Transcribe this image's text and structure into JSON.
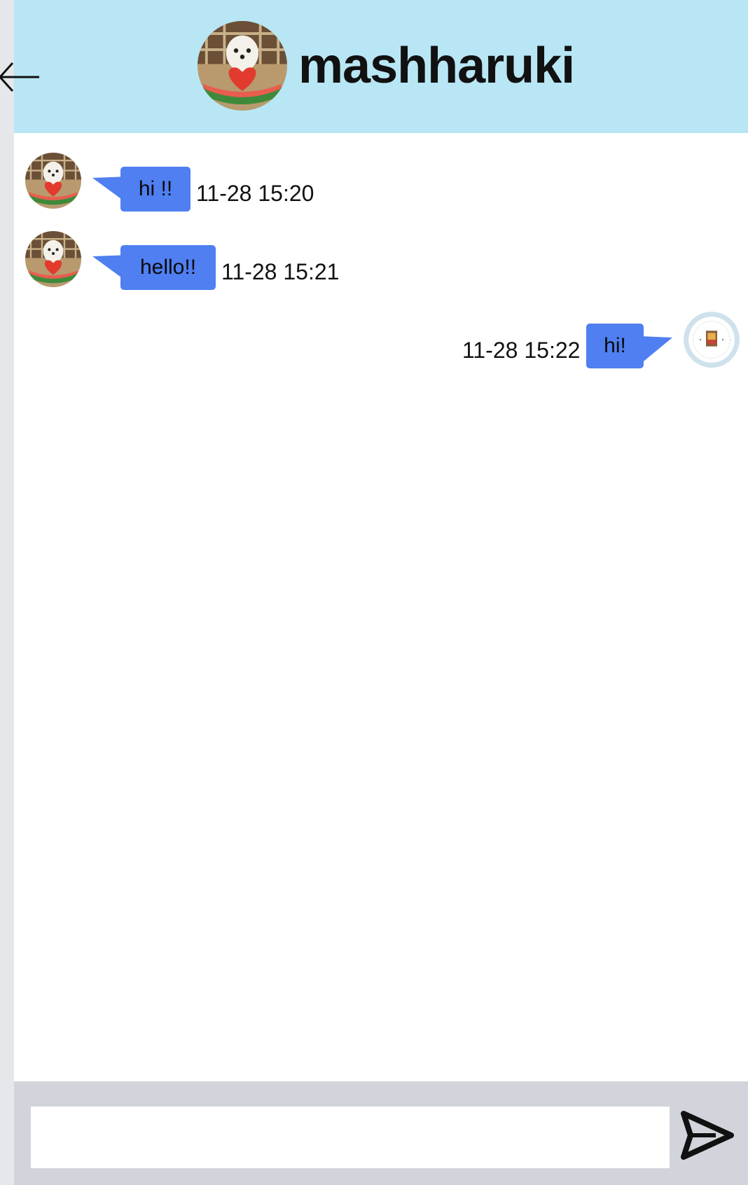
{
  "header": {
    "title": "mashharuki",
    "back_icon": "arrow-left-icon",
    "avatar": "avatar"
  },
  "colors": {
    "header_bg": "#b8e6f4",
    "bubble": "#4f7ff0",
    "composer_bg": "#d1d5db",
    "page_bg": "#e5e7eb"
  },
  "messages": [
    {
      "sender": "other",
      "text": "hi !!",
      "time": "11-28 15:20"
    },
    {
      "sender": "other",
      "text": "hello!!",
      "time": "11-28 15:21"
    },
    {
      "sender": "self",
      "text": "hi!",
      "time": "11-28 15:22"
    }
  ],
  "composer": {
    "value": "",
    "placeholder": "",
    "send_icon": "send-icon"
  }
}
